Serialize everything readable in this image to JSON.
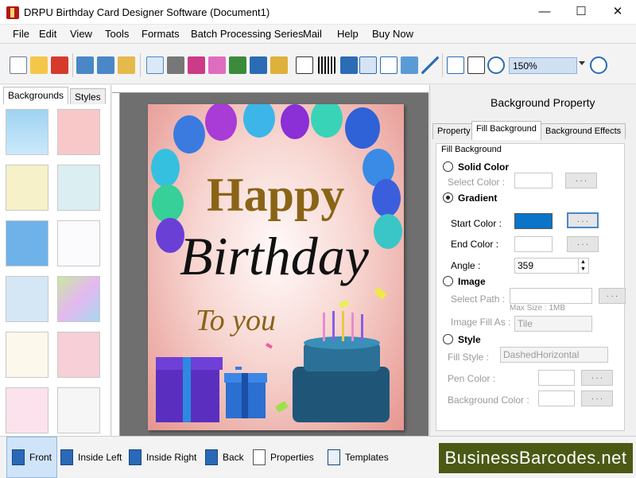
{
  "window": {
    "title": "DRPU Birthday Card Designer Software (Document1)",
    "minimize": "—",
    "maximize": "☐",
    "close": "✕"
  },
  "menu": [
    "File",
    "Edit",
    "View",
    "Tools",
    "Formats",
    "Batch Processing Series",
    "Mail",
    "Help",
    "Buy Now"
  ],
  "toolbar": {
    "zoom_value": "150%"
  },
  "left_panel": {
    "tabs": [
      "Backgrounds",
      "Styles"
    ]
  },
  "card": {
    "line1": "Happy",
    "line2": "Birthday",
    "line3": "To you"
  },
  "right_panel": {
    "title": "Background Property",
    "tabs": [
      "Property",
      "Fill Background",
      "Background Effects"
    ],
    "group": "Fill Background",
    "solid": {
      "label": "Solid Color",
      "select_color": "Select Color :"
    },
    "gradient": {
      "label": "Gradient",
      "start_color": "Start Color :",
      "end_color": "End Color :",
      "angle": "Angle :",
      "angle_value": "359"
    },
    "image": {
      "label": "Image",
      "path": "Select Path :",
      "max": "Max Size : 1MB",
      "fill_as": "Image Fill As :",
      "fill_value": "Tile"
    },
    "style": {
      "label": "Style",
      "fill_style": "Fill Style :",
      "fill_style_value": "DashedHorizontal",
      "pen_color": "Pen Color :",
      "bg_color": "Background Color :"
    },
    "dots": ". . .",
    "start_color_hex": "#0a74c8"
  },
  "bottom": {
    "buttons": [
      "Front",
      "Inside Left",
      "Inside Right",
      "Back",
      "Properties",
      "Templates"
    ]
  },
  "brand": "BusinessBarcodes.net"
}
